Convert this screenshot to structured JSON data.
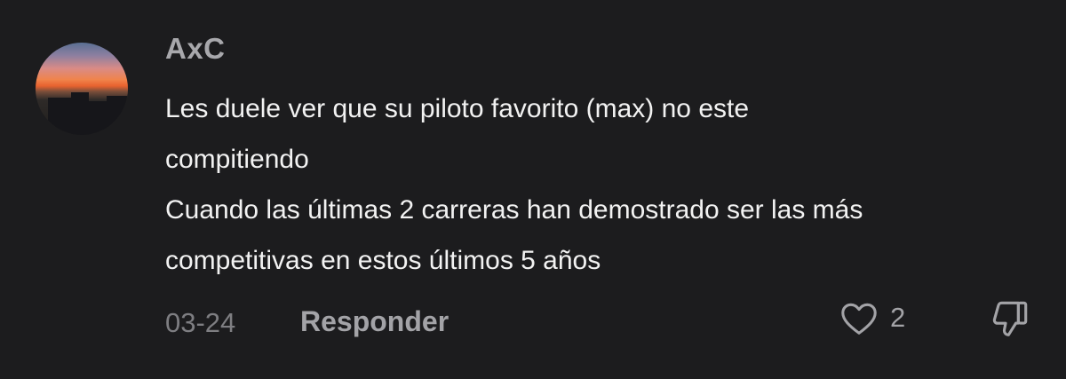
{
  "comment": {
    "username": "AxC",
    "lines": [
      "Les duele ver que su piloto favorito (max) no este",
      "compitiendo",
      "Cuando las últimas 2 carreras han demostrado ser las más",
      "competitivas en estos últimos 5 años"
    ],
    "date": "03-24",
    "reply_label": "Responder",
    "like_count": "2"
  },
  "icons": {
    "like": "heart-icon",
    "dislike": "thumbs-down-icon"
  },
  "colors": {
    "background": "#1c1c1e",
    "text": "#f2f2f2",
    "muted": "#a3a3a7"
  }
}
